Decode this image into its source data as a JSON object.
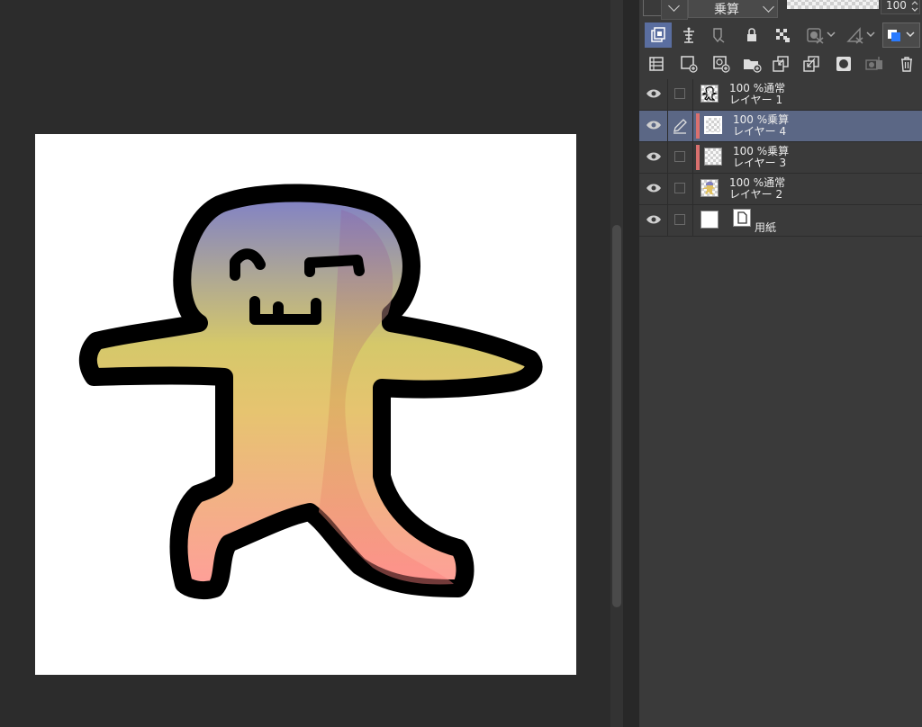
{
  "blend_toolbar": {
    "blend_mode": "乗算",
    "opacity_value": "100",
    "opacity_fraction": 1.0
  },
  "layers": [
    {
      "opacity": "100",
      "blend": "通常",
      "name": "レイヤー 1",
      "visible": true,
      "selected": false,
      "clipped": false,
      "thumb": "character-sketch"
    },
    {
      "opacity": "100",
      "blend": "乗算",
      "name": "レイヤー 4",
      "visible": true,
      "selected": true,
      "clipped": true,
      "thumb": "transparent"
    },
    {
      "opacity": "100",
      "blend": "乗算",
      "name": "レイヤー 3",
      "visible": true,
      "selected": false,
      "clipped": true,
      "thumb": "transparent"
    },
    {
      "opacity": "100",
      "blend": "通常",
      "name": "レイヤー 2",
      "visible": true,
      "selected": false,
      "clipped": false,
      "thumb": "color-fill"
    }
  ],
  "paper_layer": {
    "label": "用紙"
  },
  "colors": {
    "panel_bg": "#3a3a3a",
    "selected_layer": "#5b6785",
    "active_tool": "#5a6ea0",
    "clip_marker": "#d9706e",
    "gradient_top": "#7e7fc9",
    "gradient_mid": "#d5c86a",
    "gradient_bottom": "#ff9e9a"
  },
  "icons": {
    "prop_row": [
      "clip-to-layer-below-icon",
      "reference-layer-icon",
      "draft-layer-icon",
      "lock-icon",
      "lock-transparency-icon",
      "mask-icon",
      "ruler-icon",
      "layer-color-icon"
    ],
    "action_row": [
      "layer-properties-icon",
      "new-raster-layer-icon",
      "new-vector-layer-icon",
      "new-folder-icon",
      "transfer-to-lower-icon",
      "merge-down-icon",
      "create-mask-icon",
      "apply-mask-icon",
      "delete-layer-icon"
    ]
  }
}
